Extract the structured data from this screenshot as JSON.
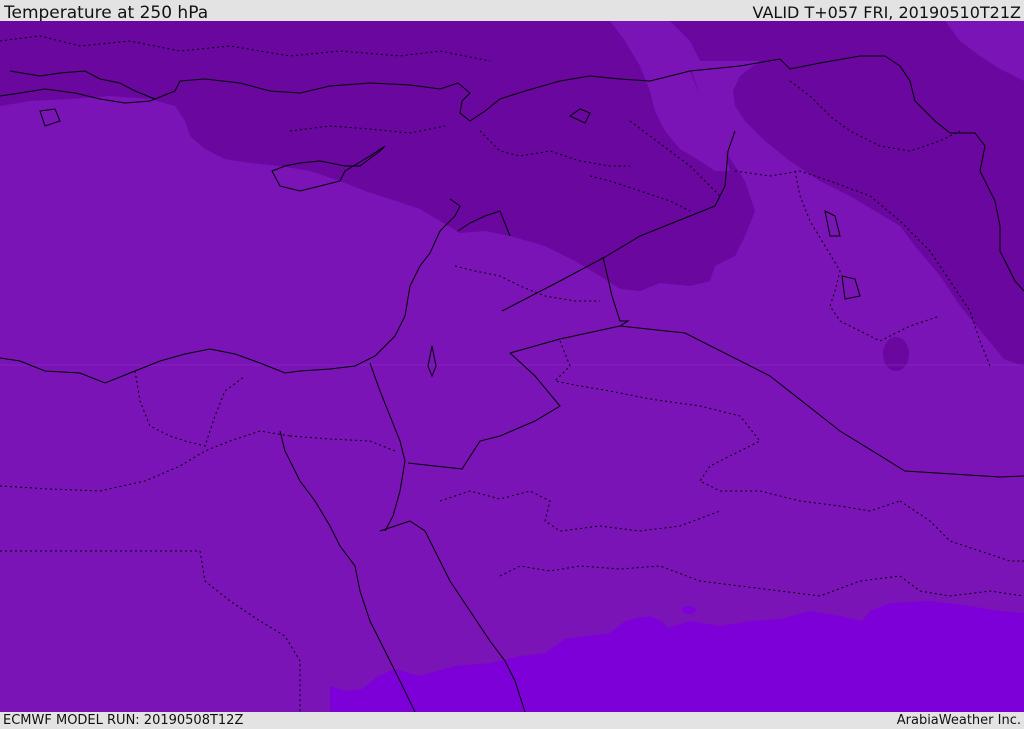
{
  "header": {
    "title": "Temperature at 250 hPa",
    "valid": "VALID T+057 FRI, 20190510T21Z"
  },
  "footer": {
    "model_run": "ECMWF MODEL RUN: 20190508T12Z",
    "credit": "ArabiaWeather Inc."
  },
  "map": {
    "colors": {
      "background_shade": "#7a14b6",
      "cold_shade": "#69079f",
      "mid_shade": "#7212ad",
      "warm_shade": "#7e00d9",
      "coastline": "#000000",
      "border": "#000000"
    }
  }
}
